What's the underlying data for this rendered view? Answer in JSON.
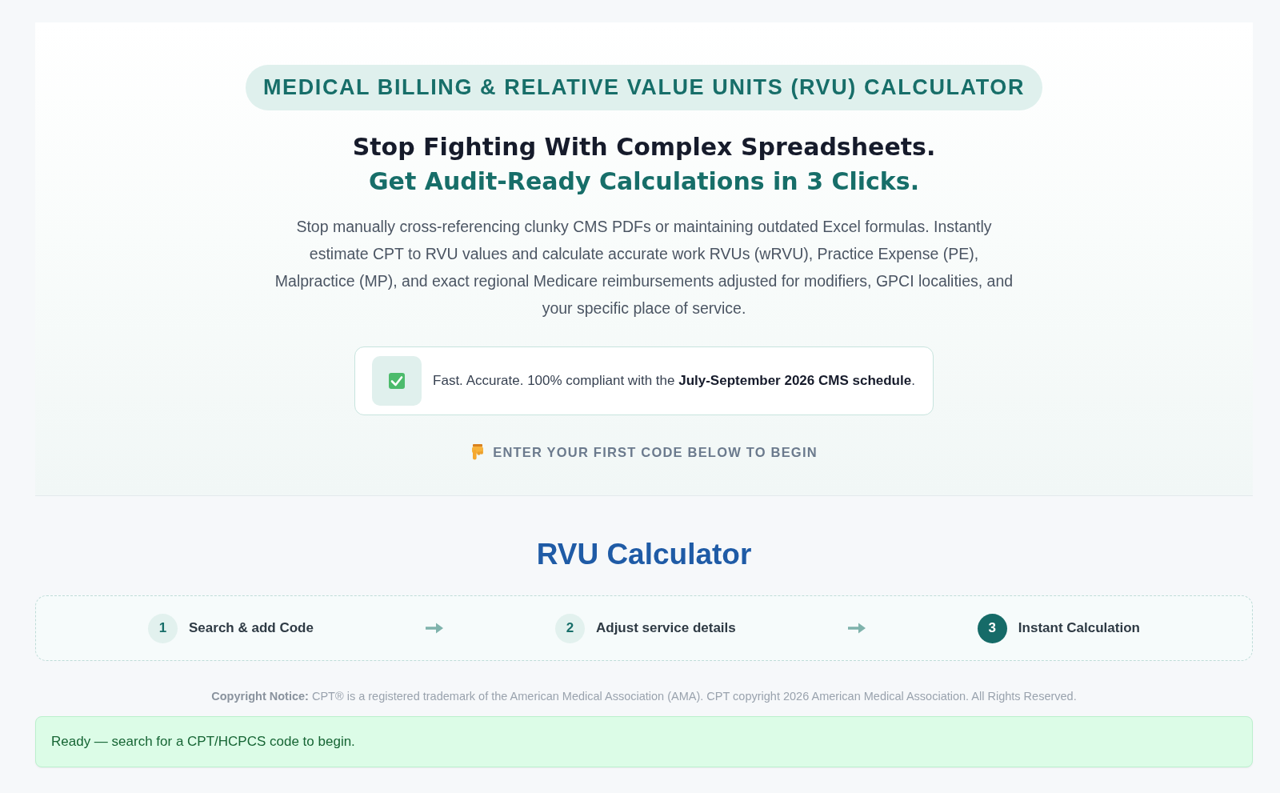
{
  "hero": {
    "badge": "MEDICAL BILLING & RELATIVE VALUE UNITS (RVU) CALCULATOR",
    "headline": "Stop Fighting With Complex Spreadsheets.",
    "subheadline": "Get Audit-Ready Calculations in 3 Clicks.",
    "description": "Stop manually cross-referencing clunky CMS PDFs or maintaining outdated Excel formulas. Instantly estimate CPT to RVU values and calculate accurate work RVUs (wRVU), Practice Expense (PE), Malpractice (MP), and exact regional Medicare reimbursements adjusted for modifiers, GPCI localities, and your specific place of service.",
    "compliance_note": "Fast. Accurate. 100% compliant with the **July-September 2026 CMS schedule**.",
    "cta_hint": "ENTER YOUR FIRST CODE BELOW TO BEGIN"
  },
  "calculator": {
    "title": "RVU Calculator",
    "steps": [
      {
        "number": "1",
        "label": "Search & add Code",
        "selected": false
      },
      {
        "number": "2",
        "label": "Adjust service details",
        "selected": false
      },
      {
        "number": "3",
        "label": "Instant Calculation",
        "selected": true
      }
    ],
    "copyright_notice": "**Copyright Notice:** CPT® is a registered trademark of the American Medical Association (AMA). CPT copyright 2026 American Medical Association. All Rights Reserved.",
    "status_message": "Ready — search for a CPT/HCPCS code to begin."
  }
}
